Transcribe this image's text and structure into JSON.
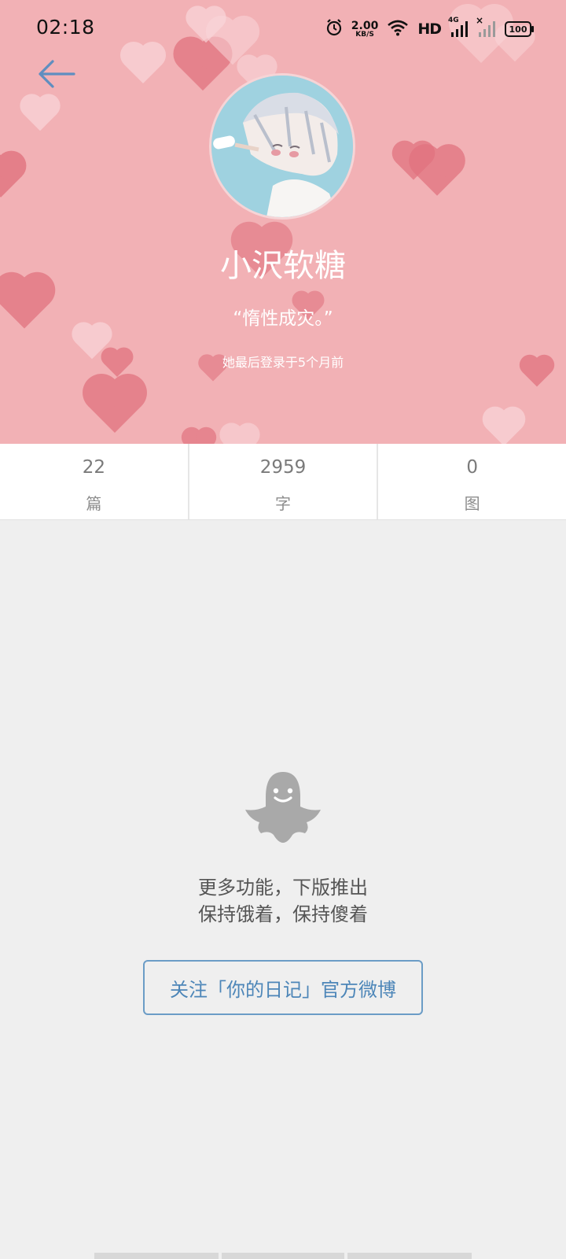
{
  "status_bar": {
    "time": "02:18",
    "speed_value": "2.00",
    "speed_unit": "KB/S",
    "hd_label": "HD",
    "network_label": "4G",
    "battery_level": "100"
  },
  "profile": {
    "name": "小沢软糖",
    "motto": "“惰性成灾。”",
    "last_login": "她最后登录于5个月前"
  },
  "stats": [
    {
      "value": "22",
      "label": "篇"
    },
    {
      "value": "2959",
      "label": "字"
    },
    {
      "value": "0",
      "label": "图"
    }
  ],
  "empty_state": {
    "line1": "更多功能，下版推出",
    "line2": "保持饿着，保持傻着",
    "follow_button": "关注「你的日记」官方微博"
  },
  "colors": {
    "header_background": "#f2b1b5",
    "heart_dark": "#e1737f",
    "heart_light": "#fad7da",
    "accent_blue": "#4d86b8",
    "page_background": "#efefef"
  },
  "icons": {
    "back": "arrow-left-icon",
    "ghost": "ghost-icon",
    "alarm": "alarm-icon",
    "wifi": "wifi-icon",
    "signal": "signal-icon",
    "battery": "battery-icon"
  }
}
